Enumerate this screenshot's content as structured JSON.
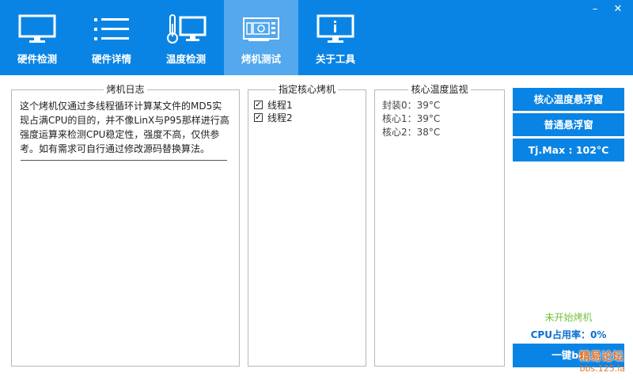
{
  "window": {
    "minimize": "–",
    "close": "✕"
  },
  "nav": [
    {
      "label": "硬件检测",
      "icon": "monitor-icon"
    },
    {
      "label": "硬件详情",
      "icon": "list-icon"
    },
    {
      "label": "温度检测",
      "icon": "thermometer-icon"
    },
    {
      "label": "烤机测试",
      "icon": "gpu-card-icon",
      "active": true
    },
    {
      "label": "关于工具",
      "icon": "info-monitor-icon"
    }
  ],
  "log_panel": {
    "title": "烤机日志",
    "text": "这个烤机仅通过多线程循环计算某文件的MD5实现占满CPU的目的，并不像LinX与P95那样进行高强度运算来检测CPU稳定性，强度不高，仅供参考。如有需求可自行通过修改源码替换算法。"
  },
  "core_panel": {
    "title": "指定核心烤机",
    "threads": [
      {
        "label": "线程1",
        "checked": true
      },
      {
        "label": "线程2",
        "checked": true
      }
    ]
  },
  "temp_panel": {
    "title": "核心温度监视",
    "lines": [
      "封装0：39°C",
      "核心1：39°C",
      "核心2：38°C"
    ]
  },
  "right": {
    "core_float_btn": "核心温度悬浮窗",
    "normal_float_btn": "普通悬浮窗",
    "tjmax_btn": "Tj.Max : 102°C",
    "status": "未开始烤机",
    "cpu_usage": "CPU占用率：0%",
    "burn_btn": "一键bo"
  },
  "watermark": {
    "title": "精易论坛",
    "url": "bbs.125.la"
  },
  "colors": {
    "accent": "#0a84e4",
    "active_tab": "#53a8ee",
    "status_green": "#74c23a"
  }
}
